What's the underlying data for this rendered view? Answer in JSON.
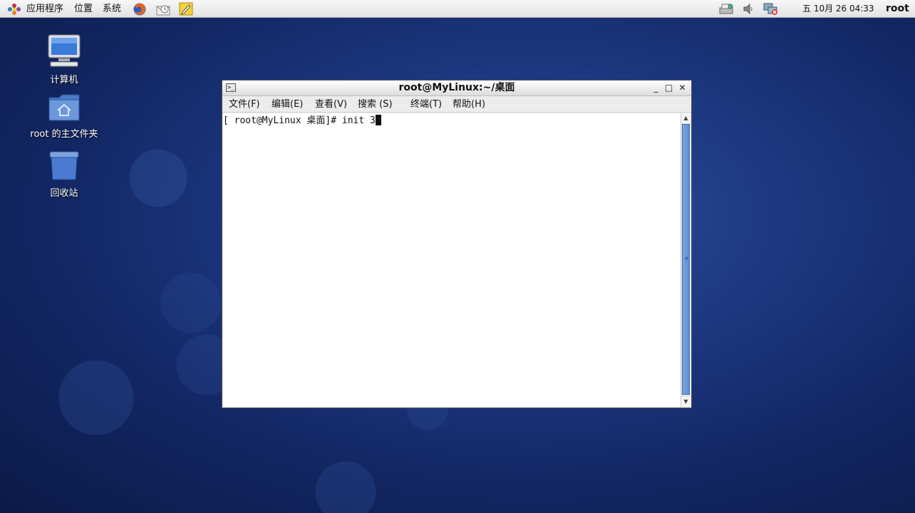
{
  "top_panel": {
    "menus": [
      "应用程序",
      "位置",
      "系统"
    ],
    "launchers": [
      "firefox-icon",
      "mail-client-icon",
      "note-editor-icon"
    ],
    "tray": [
      "network-printer-icon",
      "volume-icon",
      "network-disconnected-icon"
    ],
    "clock": "五 10月 26 04:33",
    "user": "root"
  },
  "desktop": {
    "icons": [
      {
        "label": "计算机",
        "icon": "computer-icon"
      },
      {
        "label": "root 的主文件夹",
        "icon": "home-folder-icon"
      },
      {
        "label": "回收站",
        "icon": "trash-icon"
      }
    ]
  },
  "terminal": {
    "title": "root@MyLinux:~/桌面",
    "menu": [
      "文件(F)",
      "编辑(E)",
      "查看(V)",
      "搜索 (S)",
      "终端(T)",
      "帮助(H)"
    ],
    "prompt": "[ root@MyLinux 桌面]# ",
    "command": "init 3",
    "window_buttons": {
      "minimize": "_",
      "maximize": "□",
      "close": "✕"
    }
  },
  "colors": {
    "desktop_bg": "#1d3780",
    "scrollbar_thumb": "#5b8ed6"
  }
}
